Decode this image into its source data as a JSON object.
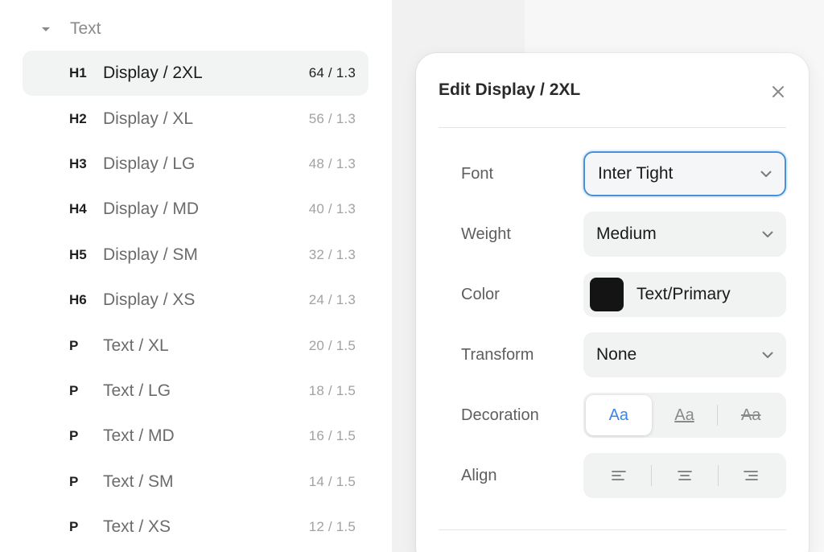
{
  "group": {
    "label": "Text"
  },
  "styles": [
    {
      "tag": "H1",
      "name": "Display / 2XL",
      "meta": "64 / 1.3",
      "selected": true
    },
    {
      "tag": "H2",
      "name": "Display / XL",
      "meta": "56 / 1.3"
    },
    {
      "tag": "H3",
      "name": "Display / LG",
      "meta": "48 / 1.3"
    },
    {
      "tag": "H4",
      "name": "Display / MD",
      "meta": "40 / 1.3"
    },
    {
      "tag": "H5",
      "name": "Display / SM",
      "meta": "32 / 1.3"
    },
    {
      "tag": "H6",
      "name": "Display / XS",
      "meta": "24 / 1.3"
    },
    {
      "tag": "P",
      "name": "Text / XL",
      "meta": "20 / 1.5"
    },
    {
      "tag": "P",
      "name": "Text / LG",
      "meta": "18 / 1.5"
    },
    {
      "tag": "P",
      "name": "Text / MD",
      "meta": "16 / 1.5"
    },
    {
      "tag": "P",
      "name": "Text / SM",
      "meta": "14 / 1.5"
    },
    {
      "tag": "P",
      "name": "Text / XS",
      "meta": "12 / 1.5"
    }
  ],
  "panel": {
    "title": "Edit Display / 2XL",
    "fields": {
      "font": {
        "label": "Font",
        "value": "Inter Tight"
      },
      "weight": {
        "label": "Weight",
        "value": "Medium"
      },
      "color": {
        "label": "Color",
        "value": "Text/Primary",
        "swatch": "#141414"
      },
      "transform": {
        "label": "Transform",
        "value": "None"
      },
      "decoration": {
        "label": "Decoration",
        "options": [
          "Aa",
          "Aa",
          "Aa"
        ],
        "active": "none"
      },
      "align": {
        "label": "Align",
        "active": "left"
      }
    }
  },
  "colors": {
    "accent": "#4a90d9",
    "active_text": "#3b86e6"
  }
}
